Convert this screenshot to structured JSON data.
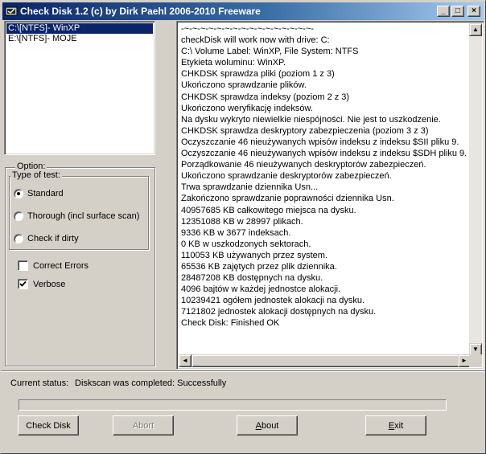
{
  "window": {
    "title": "Check Disk 1.2  (c) by Dirk Paehl  2006-2010 Freeware",
    "minimize_glyph": "_",
    "maximize_glyph": "□",
    "close_glyph": "×",
    "icon": "checkdisk-app-icon"
  },
  "drives": {
    "items": [
      {
        "label": "C:\\[NTFS]- WinXP",
        "selected": true
      },
      {
        "label": "E:\\[NTFS]- MOJE",
        "selected": false
      }
    ]
  },
  "options": {
    "group_label": "Option:",
    "type_label": "Type of test:",
    "tests": [
      {
        "label": "Standard",
        "selected": true
      },
      {
        "label": "Thorough (incl surface scan)",
        "selected": false
      },
      {
        "label": "Check if dirty",
        "selected": false
      }
    ],
    "correct_errors": {
      "label": "Correct Errors",
      "checked": false
    },
    "verbose": {
      "label": "Verbose",
      "checked": true
    }
  },
  "log": {
    "lines": [
      "-~-~-~-~-~-~-~-~-~-~-~-~-~-~-~-~-",
      "checkDisk will work now with drive: C:",
      "C:\\ Volume Label: WinXP, File System: NTFS",
      "Etykieta woluminu: WinXP.",
      "CHKDSK sprawdza pliki (poziom 1 z 3)",
      "Ukończono sprawdzanie plików.",
      "CHKDSK sprawdza indeksy (poziom 2 z 3)",
      "Ukończono weryfikację indeksów.",
      "Na dysku wykryto niewielkie niespójności. Nie jest to uszkodzenie.",
      "CHKDSK sprawdza deskryptory zabezpieczenia (poziom 3 z 3)",
      "Oczyszczanie 46 nieużywanych wpisów indeksu z indeksu $SII pliku 9.",
      "Oczyszczanie 46 nieużywanych wpisów indeksu z indeksu $SDH pliku 9.",
      "Porządkowanie 46 nieużywanych deskryptorów zabezpieczeń.",
      "Ukończono sprawdzanie deskryptorów zabezpieczeń.",
      "Trwa sprawdzanie dziennika Usn...",
      "Zakończono sprawdzanie poprawności dziennika Usn.",
      "40957685 KB całkowitego miejsca na dysku.",
      "12351088 KB w 28997 plikach.",
      "9336 KB w 3677 indeksach.",
      "0 KB w uszkodzonych sektorach.",
      "110053 KB używanych przez system.",
      "65536 KB zajętych przez plik dziennika.",
      "28487208 KB dostępnych na dysku.",
      "4096 bajtów w każdej jednostce alokacji.",
      "10239421 ogółem jednostek alokacji na dysku.",
      "7121802 jednostek alokacji dostępnych na dysku.",
      "Check Disk: Finished OK"
    ]
  },
  "status": {
    "label": "Current status:",
    "value": "Diskscan was completed: Successfully",
    "progress_fraction": 0
  },
  "buttons": {
    "check_disk": "Check Disk",
    "abort": "Abort",
    "about_first": "A",
    "about_rest": "bout",
    "exit_first": "E",
    "exit_rest": "xit"
  },
  "scrollbar": {
    "up_glyph": "▲",
    "down_glyph": "▼",
    "left_glyph": "◄",
    "right_glyph": "►"
  },
  "colors": {
    "title_gradient_start": "#0a246a",
    "title_gradient_end": "#a6caf0",
    "selection": "#0a246a",
    "face": "#d4d0c8"
  }
}
